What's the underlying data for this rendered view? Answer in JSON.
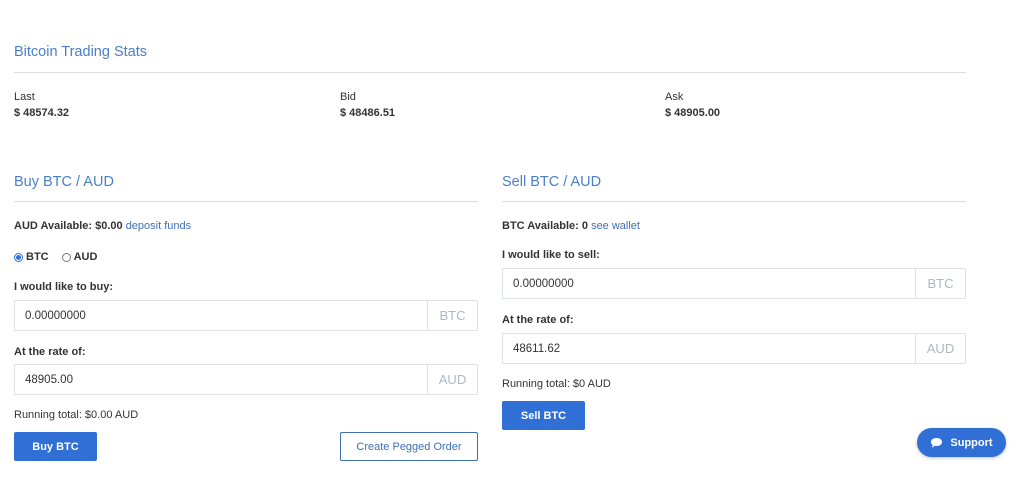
{
  "stats": {
    "title": "Bitcoin Trading Stats",
    "last": {
      "label": "Last",
      "value": "$ 48574.32"
    },
    "bid": {
      "label": "Bid",
      "value": "$ 48486.51"
    },
    "ask": {
      "label": "Ask",
      "value": "$ 48905.00"
    }
  },
  "buy": {
    "title": "Buy BTC / AUD",
    "available_text": "AUD Available: $0.00",
    "deposit_link": "deposit funds",
    "radio_options": [
      {
        "label": "BTC",
        "checked": true
      },
      {
        "label": "AUD",
        "checked": false
      }
    ],
    "amount_label": "I would like to buy:",
    "amount_value": "0.00000000",
    "amount_unit": "BTC",
    "rate_label": "At the rate of:",
    "rate_value": "48905.00",
    "rate_unit": "AUD",
    "running_total": "Running total: $0.00 AUD",
    "buy_button": "Buy BTC",
    "pegged_button": "Create Pegged Order"
  },
  "sell": {
    "title": "Sell BTC / AUD",
    "available_text": "BTC Available: 0",
    "wallet_link": "see wallet",
    "amount_label": "I would like to sell:",
    "amount_value": "0.00000000",
    "amount_unit": "BTC",
    "rate_label": "At the rate of:",
    "rate_value": "48611.62",
    "rate_unit": "AUD",
    "running_total": "Running total: $0 AUD",
    "sell_button": "Sell BTC"
  },
  "support": {
    "label": "Support",
    "icon": "chat-bubble-icon"
  },
  "colors": {
    "accent": "#2f6fd6",
    "heading": "#4a7fc8",
    "link": "#3f6fb5"
  }
}
